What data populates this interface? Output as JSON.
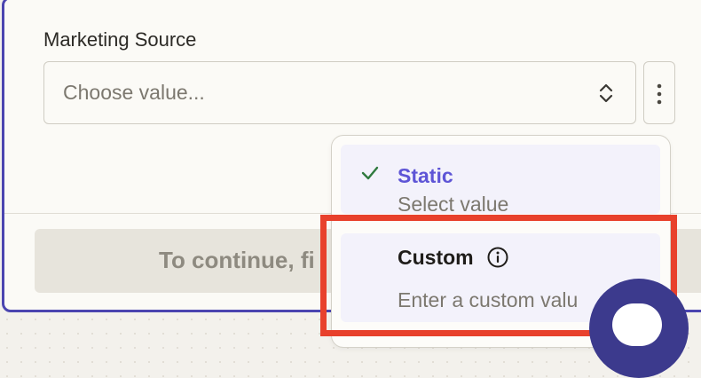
{
  "field": {
    "label": "Marketing Source",
    "placeholder": "Choose value..."
  },
  "footer": {
    "continue_label": "To continue, fi"
  },
  "dropdown": {
    "options": [
      {
        "title": "Static",
        "description": "Select value",
        "selected": true
      },
      {
        "title": "Custom",
        "description": "Enter a custom valu",
        "selected": false
      }
    ]
  },
  "icons": {
    "check": "check-icon",
    "info": "info-icon",
    "chevron": "chevron-up-down-icon",
    "more": "more-vertical-icon",
    "chat": "chat-icon"
  },
  "colors": {
    "accent": "#5e55d6",
    "panel_border": "#4b45b0",
    "check": "#2f7a3e",
    "highlight": "#e8412c",
    "chat": "#3c3a8d"
  }
}
